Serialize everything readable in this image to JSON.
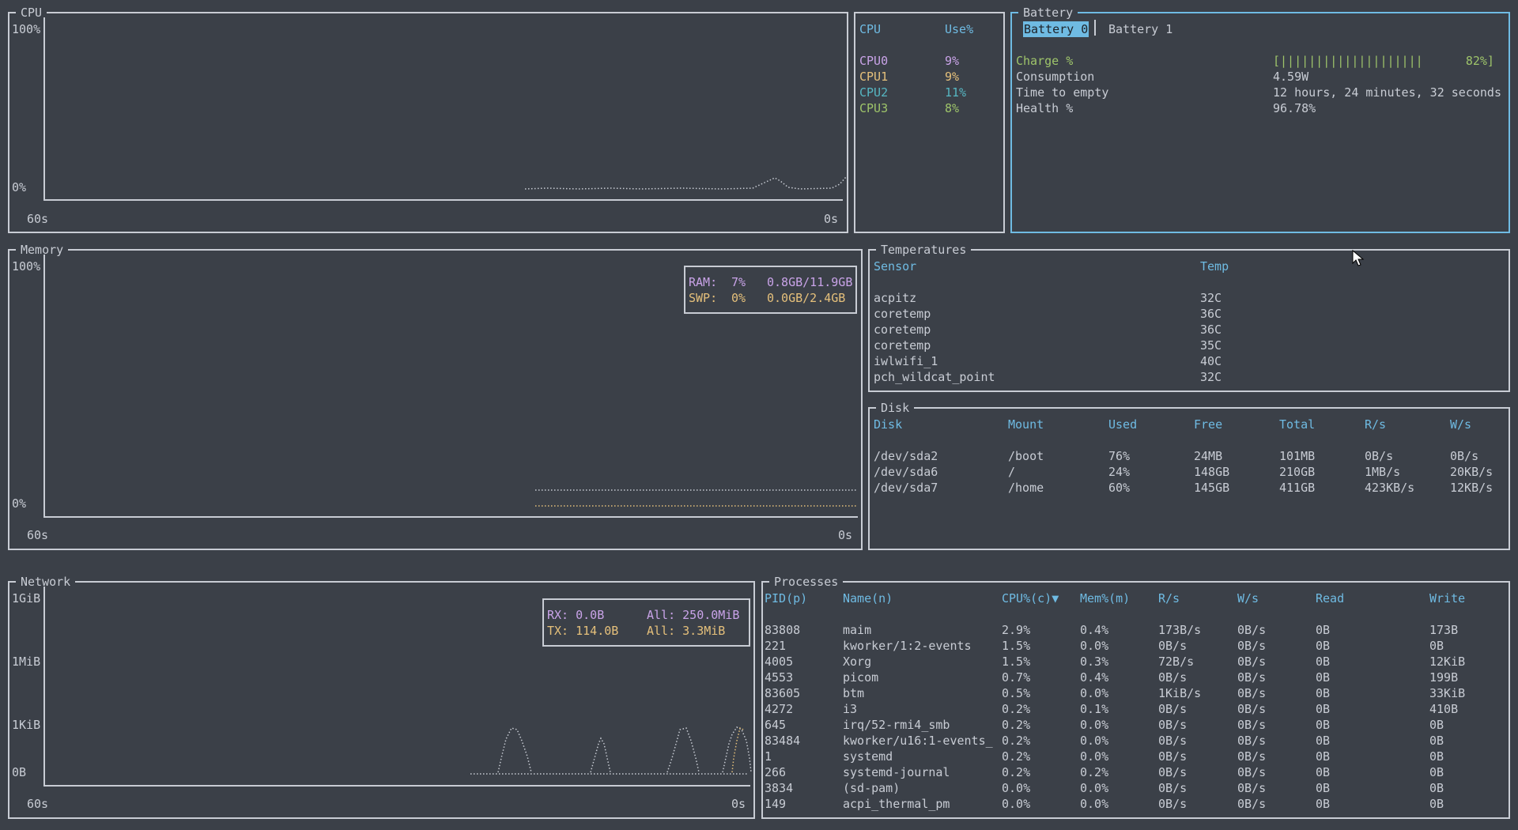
{
  "cpu_panel": {
    "title": "CPU",
    "y_top": "100%",
    "y_bottom": "0%",
    "x_left": "60s",
    "x_right": "0s",
    "header_cpu": "CPU",
    "header_use": "Use%",
    "cores": [
      {
        "name": "CPU0",
        "use": "9%",
        "color": "#c9a3e8"
      },
      {
        "name": "CPU1",
        "use": "9%",
        "color": "#e5c07b"
      },
      {
        "name": "CPU2",
        "use": "11%",
        "color": "#56b6c2"
      },
      {
        "name": "CPU3",
        "use": "8%",
        "color": "#9ec46a"
      }
    ]
  },
  "battery": {
    "title": "Battery",
    "tabs": [
      "Battery 0",
      "Battery 1"
    ],
    "selected_tab": "Battery 0",
    "charge_label": "Charge %",
    "charge_bar": "[||||||||||||||||||||      82%]",
    "charge_level": 82,
    "consumption_label": "Consumption",
    "consumption_value": "4.59W",
    "time_label": "Time to empty",
    "time_value": "12 hours, 24 minutes, 32 seconds",
    "health_label": "Health %",
    "health_value": "96.78%"
  },
  "memory": {
    "title": "Memory",
    "y_top": "100%",
    "y_bottom": "0%",
    "x_left": "60s",
    "x_right": "0s",
    "ram_label": "RAM:",
    "ram_pct": "7%",
    "ram_value": "0.8GB/11.9GB",
    "swp_label": "SWP:",
    "swp_pct": "0%",
    "swp_value": "0.0GB/2.4GB"
  },
  "temperatures": {
    "title": "Temperatures",
    "header_sensor": "Sensor",
    "header_temp": "Temp",
    "rows": [
      {
        "sensor": "acpitz",
        "temp": "32C"
      },
      {
        "sensor": "coretemp",
        "temp": "36C"
      },
      {
        "sensor": "coretemp",
        "temp": "36C"
      },
      {
        "sensor": "coretemp",
        "temp": "35C"
      },
      {
        "sensor": "iwlwifi_1",
        "temp": "40C"
      },
      {
        "sensor": "pch_wildcat_point",
        "temp": "32C"
      }
    ]
  },
  "disk": {
    "title": "Disk",
    "headers": [
      "Disk",
      "Mount",
      "Used",
      "Free",
      "Total",
      "R/s",
      "W/s"
    ],
    "rows": [
      [
        "/dev/sda2",
        "/boot",
        "76%",
        "24MB",
        "101MB",
        "0B/s",
        "0B/s"
      ],
      [
        "/dev/sda6",
        "/",
        "24%",
        "148GB",
        "210GB",
        "1MB/s",
        "20KB/s"
      ],
      [
        "/dev/sda7",
        "/home",
        "60%",
        "145GB",
        "411GB",
        "423KB/s",
        "12KB/s"
      ]
    ]
  },
  "network": {
    "title": "Network",
    "y_labels": [
      "1GiB",
      "1MiB",
      "1KiB",
      "0B"
    ],
    "x_left": "60s",
    "x_right": "0s",
    "rx_label": "RX: 0.0B",
    "rx_all": "All: 250.0MiB",
    "tx_label": "TX: 114.0B",
    "tx_all": "All: 3.3MiB"
  },
  "processes": {
    "title": "Processes",
    "headers": [
      "PID(p)",
      "Name(n)",
      "CPU%(c)▼",
      "Mem%(m)",
      "R/s",
      "W/s",
      "Read",
      "Write"
    ],
    "rows": [
      [
        "83808",
        "maim",
        "2.9%",
        "0.4%",
        "173B/s",
        "0B/s",
        "0B",
        "173B"
      ],
      [
        "221",
        "kworker/1:2-events",
        "1.5%",
        "0.0%",
        "0B/s",
        "0B/s",
        "0B",
        "0B"
      ],
      [
        "4005",
        "Xorg",
        "1.5%",
        "0.3%",
        "72B/s",
        "0B/s",
        "0B",
        "12KiB"
      ],
      [
        "4553",
        "picom",
        "0.7%",
        "0.4%",
        "0B/s",
        "0B/s",
        "0B",
        "199B"
      ],
      [
        "83605",
        "btm",
        "0.5%",
        "0.0%",
        "1KiB/s",
        "0B/s",
        "0B",
        "33KiB"
      ],
      [
        "4272",
        "i3",
        "0.2%",
        "0.1%",
        "0B/s",
        "0B/s",
        "0B",
        "410B"
      ],
      [
        "645",
        "irq/52-rmi4_smb",
        "0.2%",
        "0.0%",
        "0B/s",
        "0B/s",
        "0B",
        "0B"
      ],
      [
        "83484",
        "kworker/u16:1-events_",
        "0.2%",
        "0.0%",
        "0B/s",
        "0B/s",
        "0B",
        "0B"
      ],
      [
        "1",
        "systemd",
        "0.2%",
        "0.0%",
        "0B/s",
        "0B/s",
        "0B",
        "0B"
      ],
      [
        "266",
        "systemd-journal",
        "0.2%",
        "0.2%",
        "0B/s",
        "0B/s",
        "0B",
        "0B"
      ],
      [
        "3834",
        "(sd-pam)",
        "0.0%",
        "0.0%",
        "0B/s",
        "0B/s",
        "0B",
        "0B"
      ],
      [
        "149",
        "acpi_thermal_pm",
        "0.0%",
        "0.0%",
        "0B/s",
        "0B/s",
        "0B",
        "0B"
      ]
    ]
  }
}
